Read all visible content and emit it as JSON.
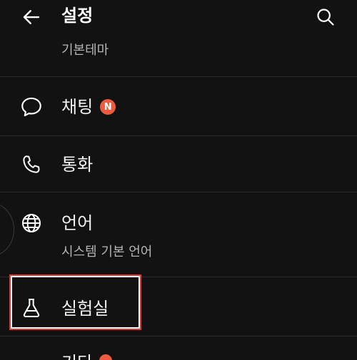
{
  "header": {
    "title": "설정"
  },
  "rows": {
    "theme_sub": "기본테마",
    "chat_label": "채팅",
    "chat_badge": "N",
    "call_label": "통화",
    "language_label": "언어",
    "language_sub": "시스템 기본 언어",
    "labs_label": "실험실",
    "other_label": "기타"
  },
  "colors": {
    "background": "#121212",
    "badge": "#ec5b3f",
    "highlight": "#e53935"
  },
  "icons": {
    "back": "arrow-left-icon",
    "search": "search-icon",
    "chat": "speech-bubble-icon",
    "call": "phone-icon",
    "language": "globe-icon",
    "labs": "flask-icon"
  }
}
